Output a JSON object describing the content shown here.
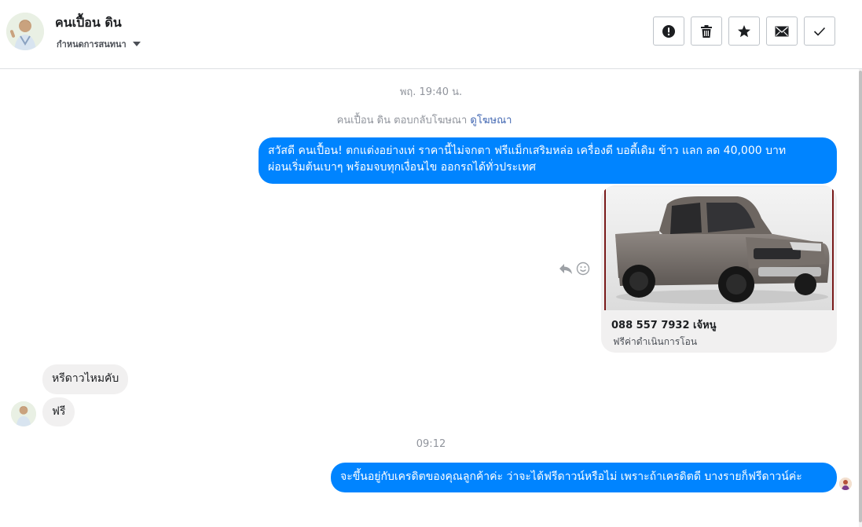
{
  "header": {
    "contact_name": "คนเปื้อน ดิน",
    "conversation_action_label": "กำหนดการสนทนา",
    "toolbar": [
      {
        "name": "mark-spam-button",
        "icon": "exclamation-icon"
      },
      {
        "name": "delete-button",
        "icon": "trash-icon"
      },
      {
        "name": "star-button",
        "icon": "star-icon"
      },
      {
        "name": "mark-unread-button",
        "icon": "envelope-icon"
      },
      {
        "name": "mark-done-button",
        "icon": "check-icon"
      }
    ]
  },
  "messages": {
    "timestamp_1": "พฤ. 19:40 น.",
    "reply_note_prefix": "คนเปื้อน ดิน ตอบกลับโฆษณา",
    "reply_note_link": "ดูโฆษณา",
    "outgoing_1_line_1": "สวัสดี คนเปื้อน! ตกแต่งอย่างเท่ ราคานี้ไม่จกตา ฟรีแม็กเสริมหล่อ เครื่องดี บอดี้เดิม ข้าว แลก ลด 40,000 บาท",
    "outgoing_1_line_2": "ผ่อนเริ่มต้นเบาๆ พร้อมจบทุกเงื่อนไข ออกรถได้ทั่วประเทศ",
    "card": {
      "title": "088 557 7932 เจ้หนู",
      "subtitle": "ฟรีค่าดำเนินการโอน"
    },
    "incoming_1": "หรีดาวไหมคับ",
    "incoming_2": "ฟรี",
    "timestamp_2": "09:12",
    "outgoing_2": "จะขึ้นอยู่กับเครดิตของคุณลูกค้าค่ะ ว่าจะได้ฟรีดาวน์หรือไม่ เพราะถ้าเครดิตดี บางรายก็ฟรีดาวน์ค่ะ"
  },
  "colors": {
    "outgoing_bubble": "#0084ff",
    "incoming_bubble": "#f1f0f0",
    "link": "#4267b2",
    "muted_text": "#90949c"
  }
}
